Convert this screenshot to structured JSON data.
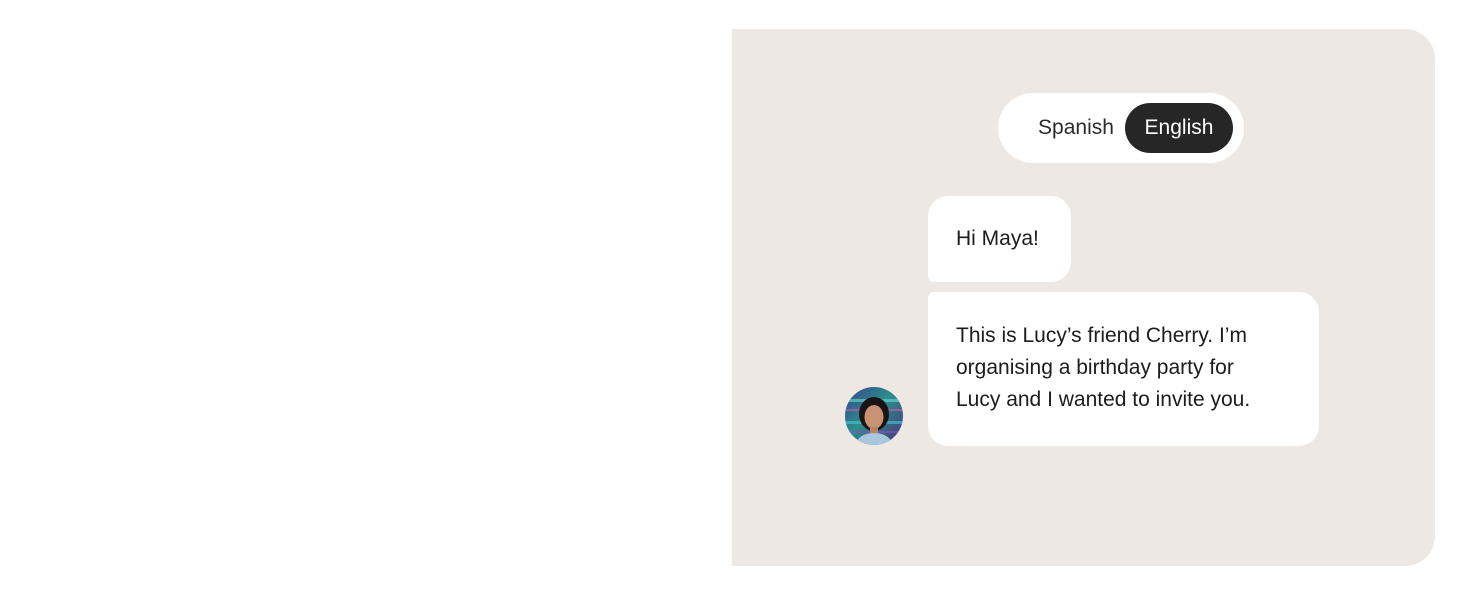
{
  "language_toggle": {
    "options": [
      "Spanish",
      "English"
    ],
    "selected": "English"
  },
  "chat": {
    "messages": [
      {
        "lines": [
          "Hi Maya!"
        ]
      },
      {
        "lines": [
          "This is Lucy’s friend Cherry. I’m",
          "organising a birthday party for",
          "Lucy and I wanted to invite you."
        ]
      }
    ],
    "avatar_icon": "person-photo-avatar"
  },
  "colors": {
    "panel_background": "#ede8e4",
    "bubble_background": "#ffffff",
    "selected_toggle": "#262626"
  }
}
